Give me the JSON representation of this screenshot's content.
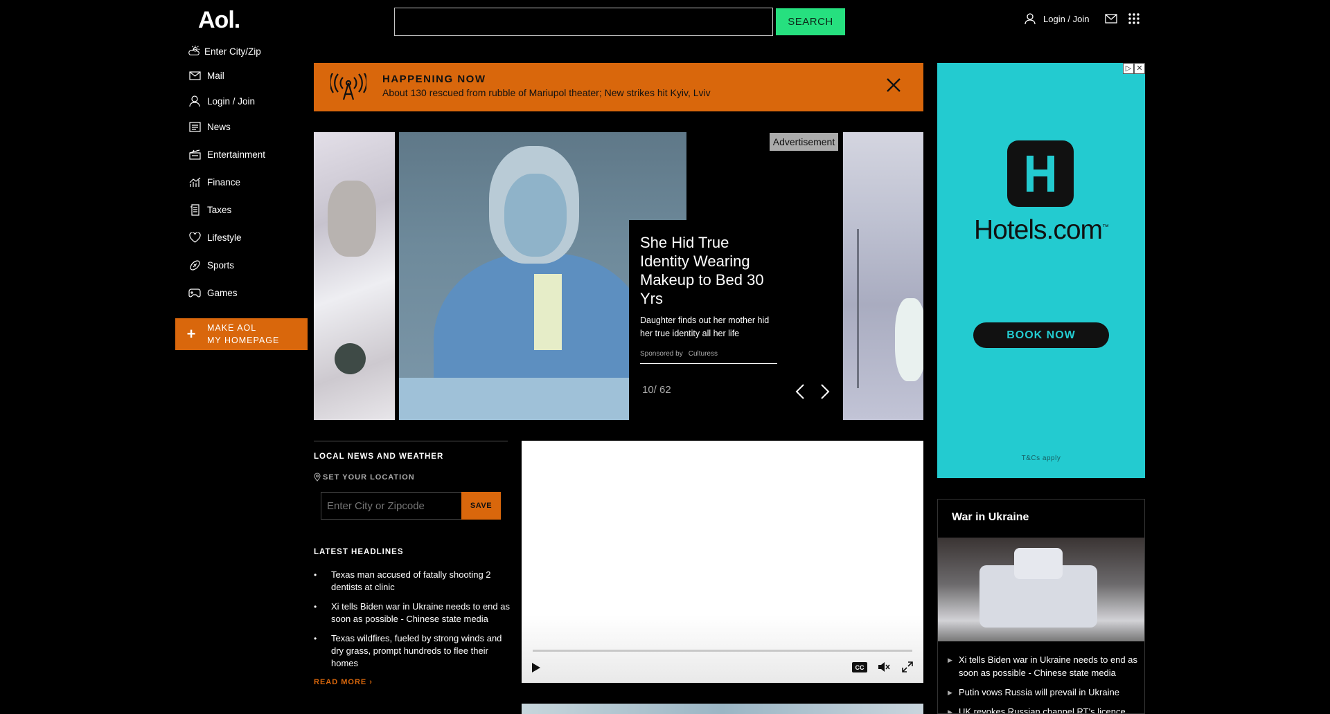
{
  "header": {
    "logo": "Aol.",
    "search_placeholder": "",
    "search_button": "SEARCH",
    "login_label": "Login / Join"
  },
  "nav": {
    "weather": "Enter City/Zip",
    "items": [
      {
        "label": "Mail",
        "icon": "mail-icon"
      },
      {
        "label": "Login / Join",
        "icon": "user-icon"
      },
      {
        "label": "News",
        "icon": "news-icon"
      },
      {
        "label": "Entertainment",
        "icon": "clapperboard-icon"
      },
      {
        "label": "Finance",
        "icon": "chart-icon"
      },
      {
        "label": "Taxes",
        "icon": "receipt-icon"
      },
      {
        "label": "Lifestyle",
        "icon": "heart-icon"
      },
      {
        "label": "Sports",
        "icon": "football-icon"
      },
      {
        "label": "Games",
        "icon": "gamepad-icon"
      }
    ],
    "homepage_line1": "MAKE AOL",
    "homepage_line2": "MY HOMEPAGE"
  },
  "happening": {
    "title": "HAPPENING NOW",
    "subtitle": "About 130 rescued from rubble of Mariupol theater; New strikes hit Kyiv, Lviv"
  },
  "carousel": {
    "ad_label": "Advertisement",
    "title": "She Hid True Identity Wearing Makeup to Bed 30 Yrs",
    "description": "Daughter finds out her mother hid her true identity all her life",
    "sponsored_prefix": "Sponsored by",
    "sponsor": "Culturess",
    "counter": "10/ 62"
  },
  "local": {
    "heading": "LOCAL NEWS AND WEATHER",
    "set_location": "SET YOUR LOCATION",
    "zip_placeholder": "Enter City or Zipcode",
    "save": "SAVE"
  },
  "headlines": {
    "heading": "LATEST HEADLINES",
    "items": [
      "Texas man accused of fatally shooting 2 dentists at clinic",
      "Xi tells Biden war in Ukraine needs to end as soon as possible - Chinese state media",
      "Texas wildfires, fueled by strong winds and dry grass, prompt hundreds to flee their homes"
    ],
    "read_more": "READ MORE ›"
  },
  "video": {
    "cc": "CC",
    "progress": 0
  },
  "ad": {
    "brand": "Hotels.com",
    "tm": "™",
    "button": "BOOK NOW",
    "terms": "T&Cs apply",
    "accent": "#23cbd0"
  },
  "war": {
    "title": "War in Ukraine",
    "items": [
      "Xi tells Biden war in Ukraine needs to end as soon as possible - Chinese state media",
      "Putin vows Russia will prevail in Ukraine",
      "UK revokes Russian channel RT's licence"
    ]
  },
  "colors": {
    "accent_orange": "#d9670c",
    "search_green": "#26e07f"
  }
}
